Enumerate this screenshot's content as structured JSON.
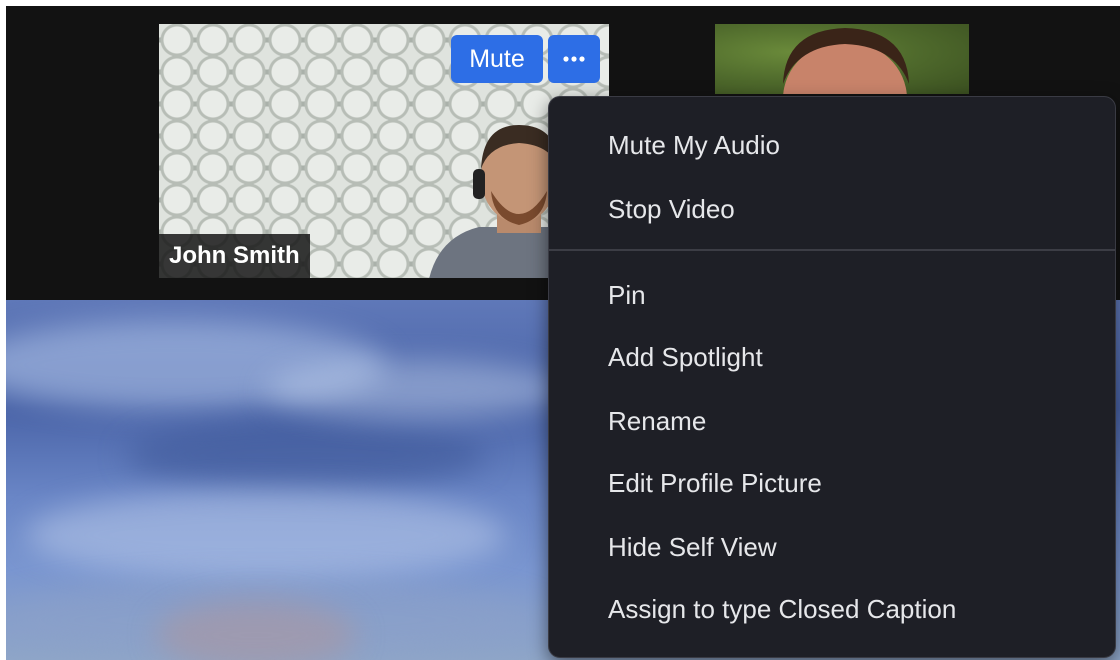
{
  "self_view": {
    "participant_name": "John Smith",
    "mute_button_label": "Mute",
    "more_button_icon": "more-options-icon"
  },
  "context_menu": {
    "groups": [
      [
        "Mute My Audio",
        "Stop Video"
      ],
      [
        "Pin",
        "Add Spotlight",
        "Rename",
        "Edit Profile Picture",
        "Hide Self View",
        "Assign to type Closed Caption"
      ]
    ]
  },
  "colors": {
    "accent_blue": "#2d6ee6",
    "menu_background": "#1e1f26",
    "menu_text": "#e6e7ea",
    "gallery_background": "#121212"
  }
}
